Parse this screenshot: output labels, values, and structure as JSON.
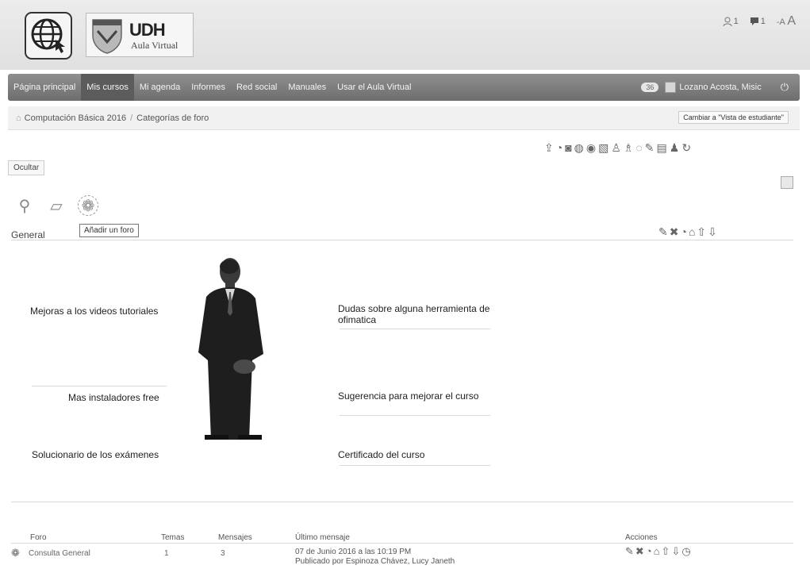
{
  "header": {
    "logo_udh": "UDH",
    "logo_aula": "Aula Virtual",
    "messages_count": "1",
    "notifications_count": "1",
    "font_small": "A",
    "font_large": "A",
    "font_minus": "-"
  },
  "nav": {
    "items": [
      "Página principal",
      "Mis cursos",
      "Mi agenda",
      "Informes",
      "Red social",
      "Manuales",
      "Usar el Aula Virtual"
    ],
    "active_index": 1,
    "badge": "36",
    "user_name": "Lozano Acosta, Misic"
  },
  "breadcrumb": {
    "course": "Computación Básica 2016",
    "page": "Categorías de foro",
    "separator": "/",
    "student_view": "Cambiar a \"Vista de estudiante\""
  },
  "controls": {
    "hide_label": "Ocultar",
    "tooltip": "Añadir un foro"
  },
  "section": {
    "title": "General"
  },
  "forums": {
    "left": [
      "Mejoras a los videos tutoriales",
      "Mas instaladores free",
      "Solucionario de los exámenes"
    ],
    "right": [
      "Dudas sobre alguna herramienta de ofimatica",
      "Sugerencia para mejorar el curso",
      "Certificado del curso"
    ]
  },
  "table": {
    "headers": [
      "Foro",
      "Temas",
      "Mensajes",
      "Último mensaje",
      "Acciones"
    ],
    "rows": [
      {
        "forum": "Consulta General",
        "topics": "1",
        "messages": "3",
        "last_date": "07 de Junio 2016 a las 10:19 PM",
        "last_author": "Publicado por Espinoza Chávez, Lucy Janeth"
      }
    ]
  },
  "colors": {
    "navbar": "#7a7a7a",
    "header_bg": "#e6e6e6"
  }
}
